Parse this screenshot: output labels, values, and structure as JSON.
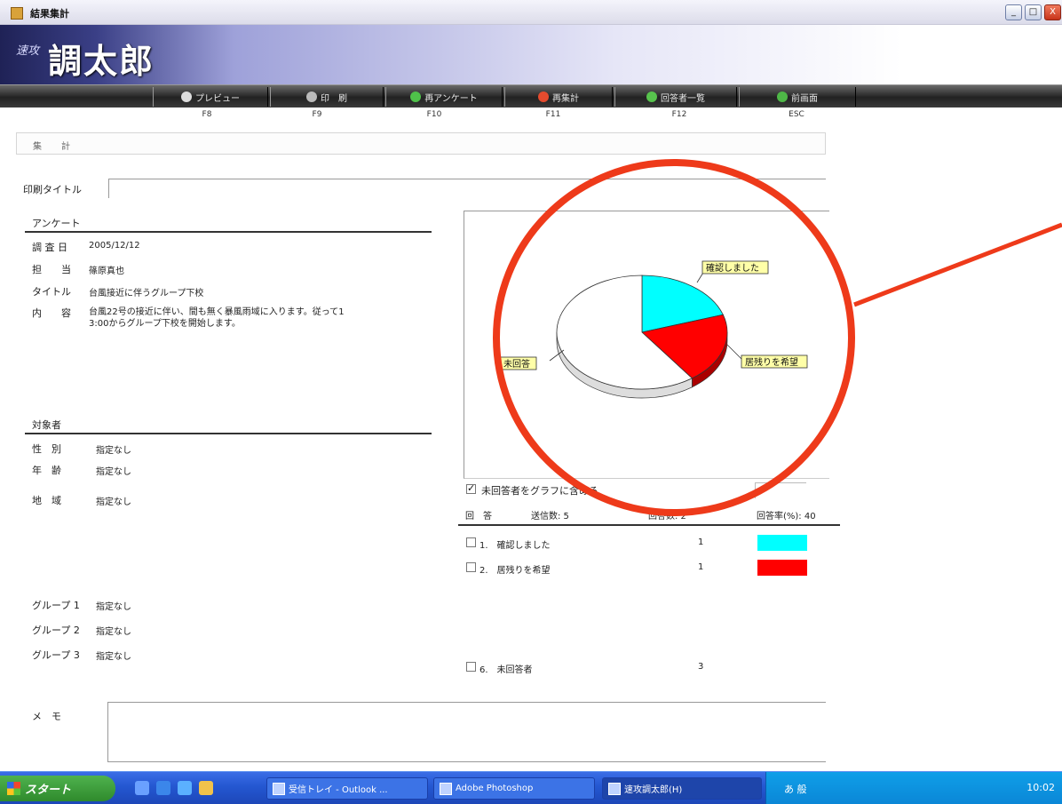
{
  "window": {
    "title": "結果集計",
    "btn_min": "_",
    "btn_max": "□",
    "btn_close": "X"
  },
  "banner": {
    "logo_small": "速攻",
    "logo": "調太郎"
  },
  "toolbar": {
    "buttons": [
      {
        "label": "プレビュー",
        "key": "F8"
      },
      {
        "label": "印　刷",
        "key": "F9"
      },
      {
        "label": "再アンケート",
        "key": "F10"
      },
      {
        "label": "再集計",
        "key": "F11"
      },
      {
        "label": "回答者一覧",
        "key": "F12"
      },
      {
        "label": "前画面",
        "key": "ESC"
      }
    ]
  },
  "section": {
    "title": "集　計"
  },
  "print_title": {
    "label": "印刷タイトル",
    "value": ""
  },
  "survey": {
    "header": "アンケート",
    "rows": [
      {
        "label": "調 査 日",
        "value": "2005/12/12"
      },
      {
        "label": "担　　当",
        "value": "篠原真也"
      },
      {
        "label": "タイトル",
        "value": "台風接近に伴うグループ下校"
      },
      {
        "label": "内　　容",
        "value": "台風22号の接近に伴い、間も無く暴風雨域に入ります。従って1\n3:00からグループ下校を開始します。"
      }
    ]
  },
  "target": {
    "header": "対象者",
    "rows": [
      {
        "label": "性　別",
        "value": "指定なし"
      },
      {
        "label": "年　齢",
        "value": "指定なし"
      },
      {
        "label": "地　域",
        "value": "指定なし"
      }
    ],
    "groups": [
      {
        "label": "グループ 1",
        "value": "指定なし"
      },
      {
        "label": "グループ 2",
        "value": "指定なし"
      },
      {
        "label": "グループ 3",
        "value": "指定なし"
      }
    ]
  },
  "chart_data": {
    "type": "pie",
    "title": "",
    "slices": [
      {
        "label": "確認しました",
        "value": 1,
        "color": "#00ffff"
      },
      {
        "label": "居残りを希望",
        "value": 1,
        "color": "#ff0000"
      },
      {
        "label": "未回答",
        "value": 3,
        "color": "#ffffff"
      }
    ]
  },
  "stats": {
    "include_unanswered_label": "未回答者をグラフに含める",
    "include_unanswered": true,
    "answer_label": "回　答",
    "sent_label": "送信数: 5",
    "answered_label": "回答数: 2",
    "rate_label": "回答率(%): 40",
    "answers": [
      {
        "label": "1.　確認しました",
        "count": "1",
        "color": "#00ffff"
      },
      {
        "label": "2.　居残りを希望",
        "count": "1",
        "color": "#ff0000"
      }
    ],
    "unanswered": {
      "label": "6.　未回答者",
      "count": "3"
    }
  },
  "memo": {
    "label": "メ　モ",
    "value": ""
  },
  "taskbar": {
    "start": "スタート",
    "tasks": [
      {
        "label": "受信トレイ - Outlook ..."
      },
      {
        "label": "Adobe Photoshop"
      },
      {
        "label": "速攻調太郎(H)"
      }
    ],
    "tray": "あ 般",
    "clock": "10:02"
  },
  "colors": {
    "annotation": "#ee3a1a",
    "cyan": "#00ffff",
    "red": "#ff0000"
  }
}
